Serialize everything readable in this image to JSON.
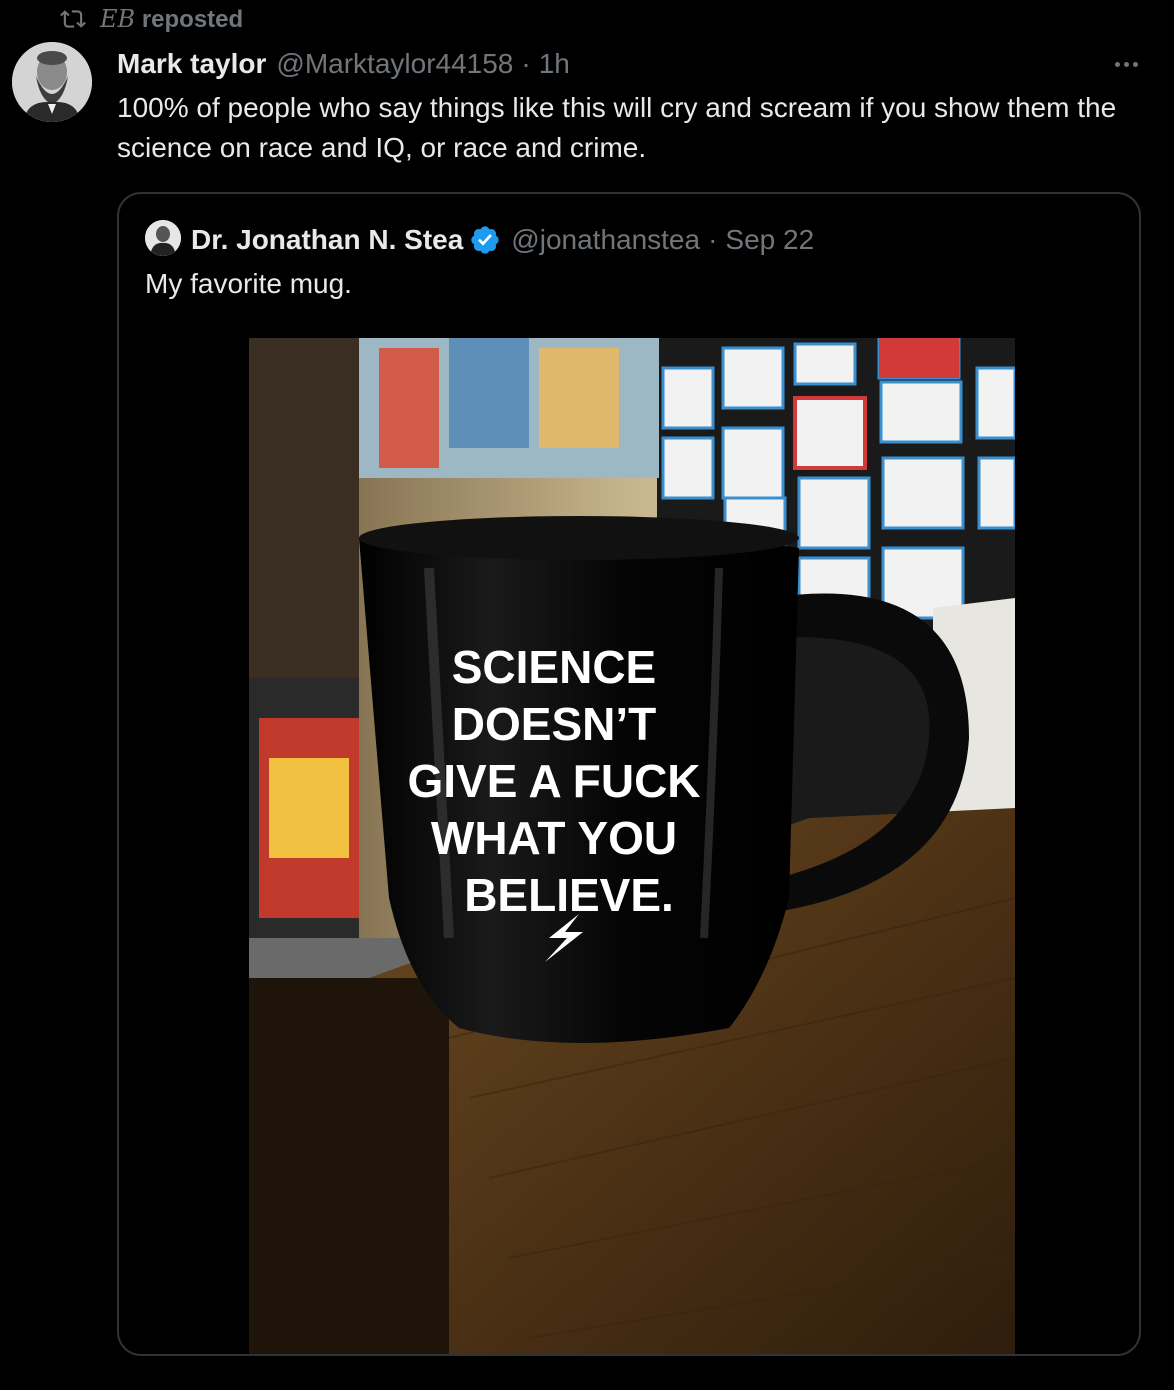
{
  "repost": {
    "initials": "EB",
    "label": "reposted"
  },
  "tweet": {
    "author_name": "Mark taylor",
    "author_handle": "@Marktaylor44158",
    "separator": "·",
    "time": "1h",
    "text": "100% of people who say things like this will cry and scream if you show them the science on race and IQ, or race and crime."
  },
  "quote": {
    "author_name": "Dr. Jonathan N. Stea",
    "author_handle": "@jonathanstea",
    "separator": "·",
    "date": "Sep 22",
    "text": "My favorite mug.",
    "image": {
      "mug_lines": [
        "SCIENCE",
        "DOESN’T",
        "GIVE A FUCK",
        "WHAT YOU",
        "BELIEVE."
      ]
    }
  },
  "icons": {
    "repost": "repost-icon",
    "more": "more-icon",
    "verified": "verified-badge-icon"
  },
  "colors": {
    "background": "#000000",
    "text_primary": "#e7e9ea",
    "text_secondary": "#71767b",
    "border": "#2f3336",
    "verified": "#1d9bf0"
  }
}
